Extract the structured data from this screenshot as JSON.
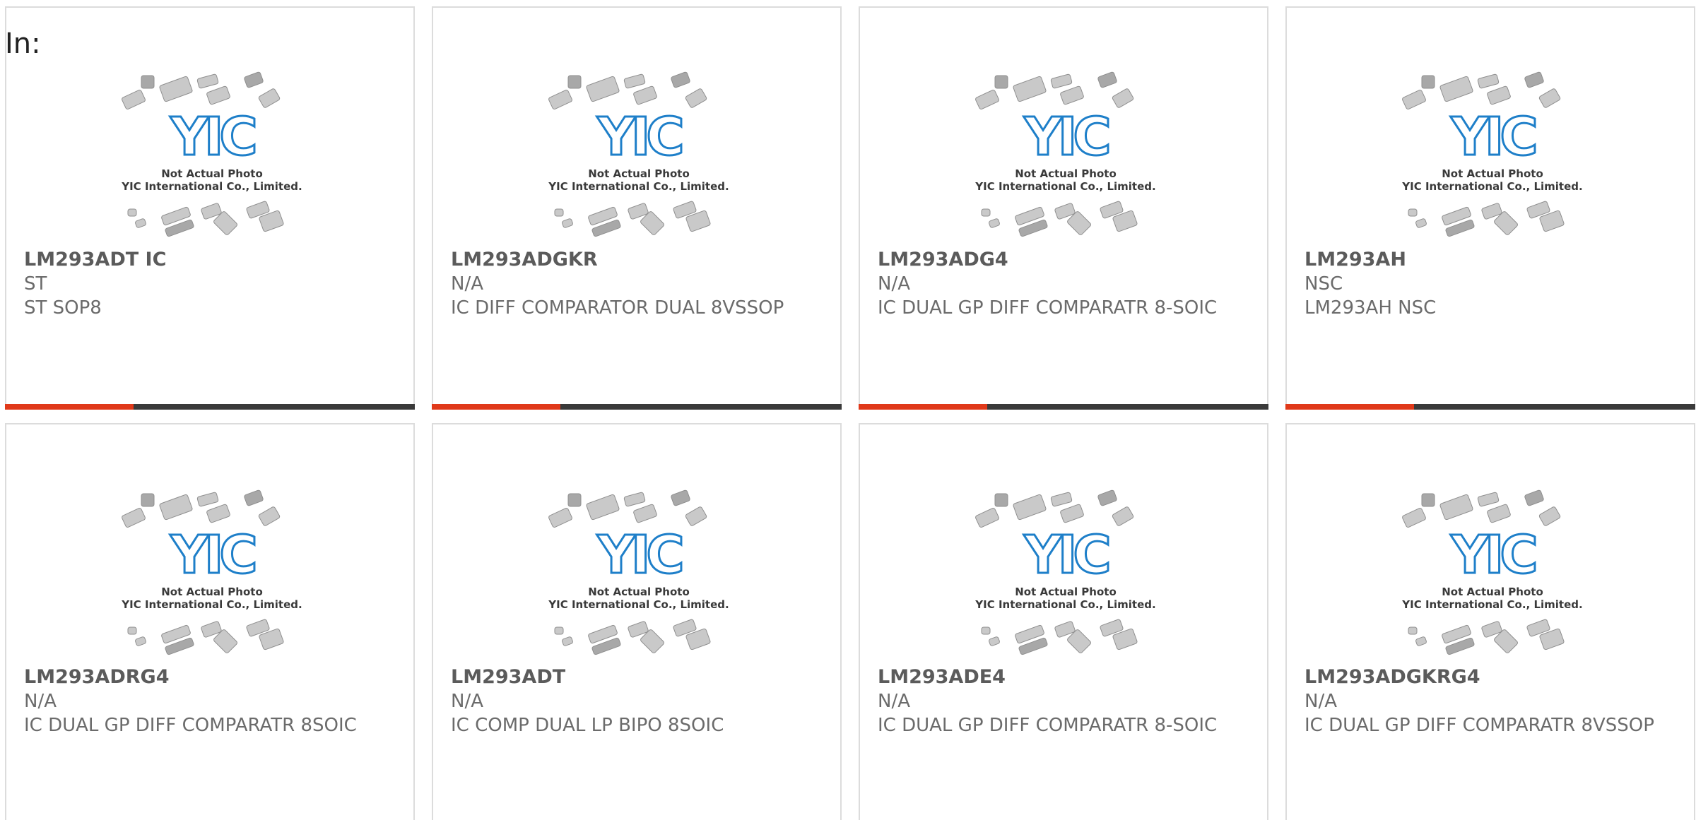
{
  "heading": "In:",
  "placeholder_image": {
    "caption_line1": "Not Actual Photo",
    "caption_line2": "YIC International Co., Limited.",
    "logo_text": "YIC",
    "logo_color": "#1e7fc9"
  },
  "accent_color": "#e0391a",
  "products": [
    {
      "part_number": "LM293ADT IC",
      "manufacturer": "ST",
      "description": "ST SOP8"
    },
    {
      "part_number": "LM293ADGKR",
      "manufacturer": "N/A",
      "description": "IC DIFF COMPARATOR DUAL 8VSSOP"
    },
    {
      "part_number": "LM293ADG4",
      "manufacturer": "N/A",
      "description": "IC DUAL GP DIFF COMPARATR 8-SOIC"
    },
    {
      "part_number": "LM293AH",
      "manufacturer": "NSC",
      "description": "LM293AH NSC"
    },
    {
      "part_number": "LM293ADRG4",
      "manufacturer": "N/A",
      "description": "IC DUAL GP DIFF COMPARATR 8SOIC"
    },
    {
      "part_number": "LM293ADT",
      "manufacturer": "N/A",
      "description": "IC COMP DUAL LP BIPO 8SOIC"
    },
    {
      "part_number": "LM293ADE4",
      "manufacturer": "N/A",
      "description": "IC DUAL GP DIFF COMPARATR 8-SOIC"
    },
    {
      "part_number": "LM293ADGKRG4",
      "manufacturer": "N/A",
      "description": "IC DUAL GP DIFF COMPARATR 8VSSOP"
    }
  ]
}
